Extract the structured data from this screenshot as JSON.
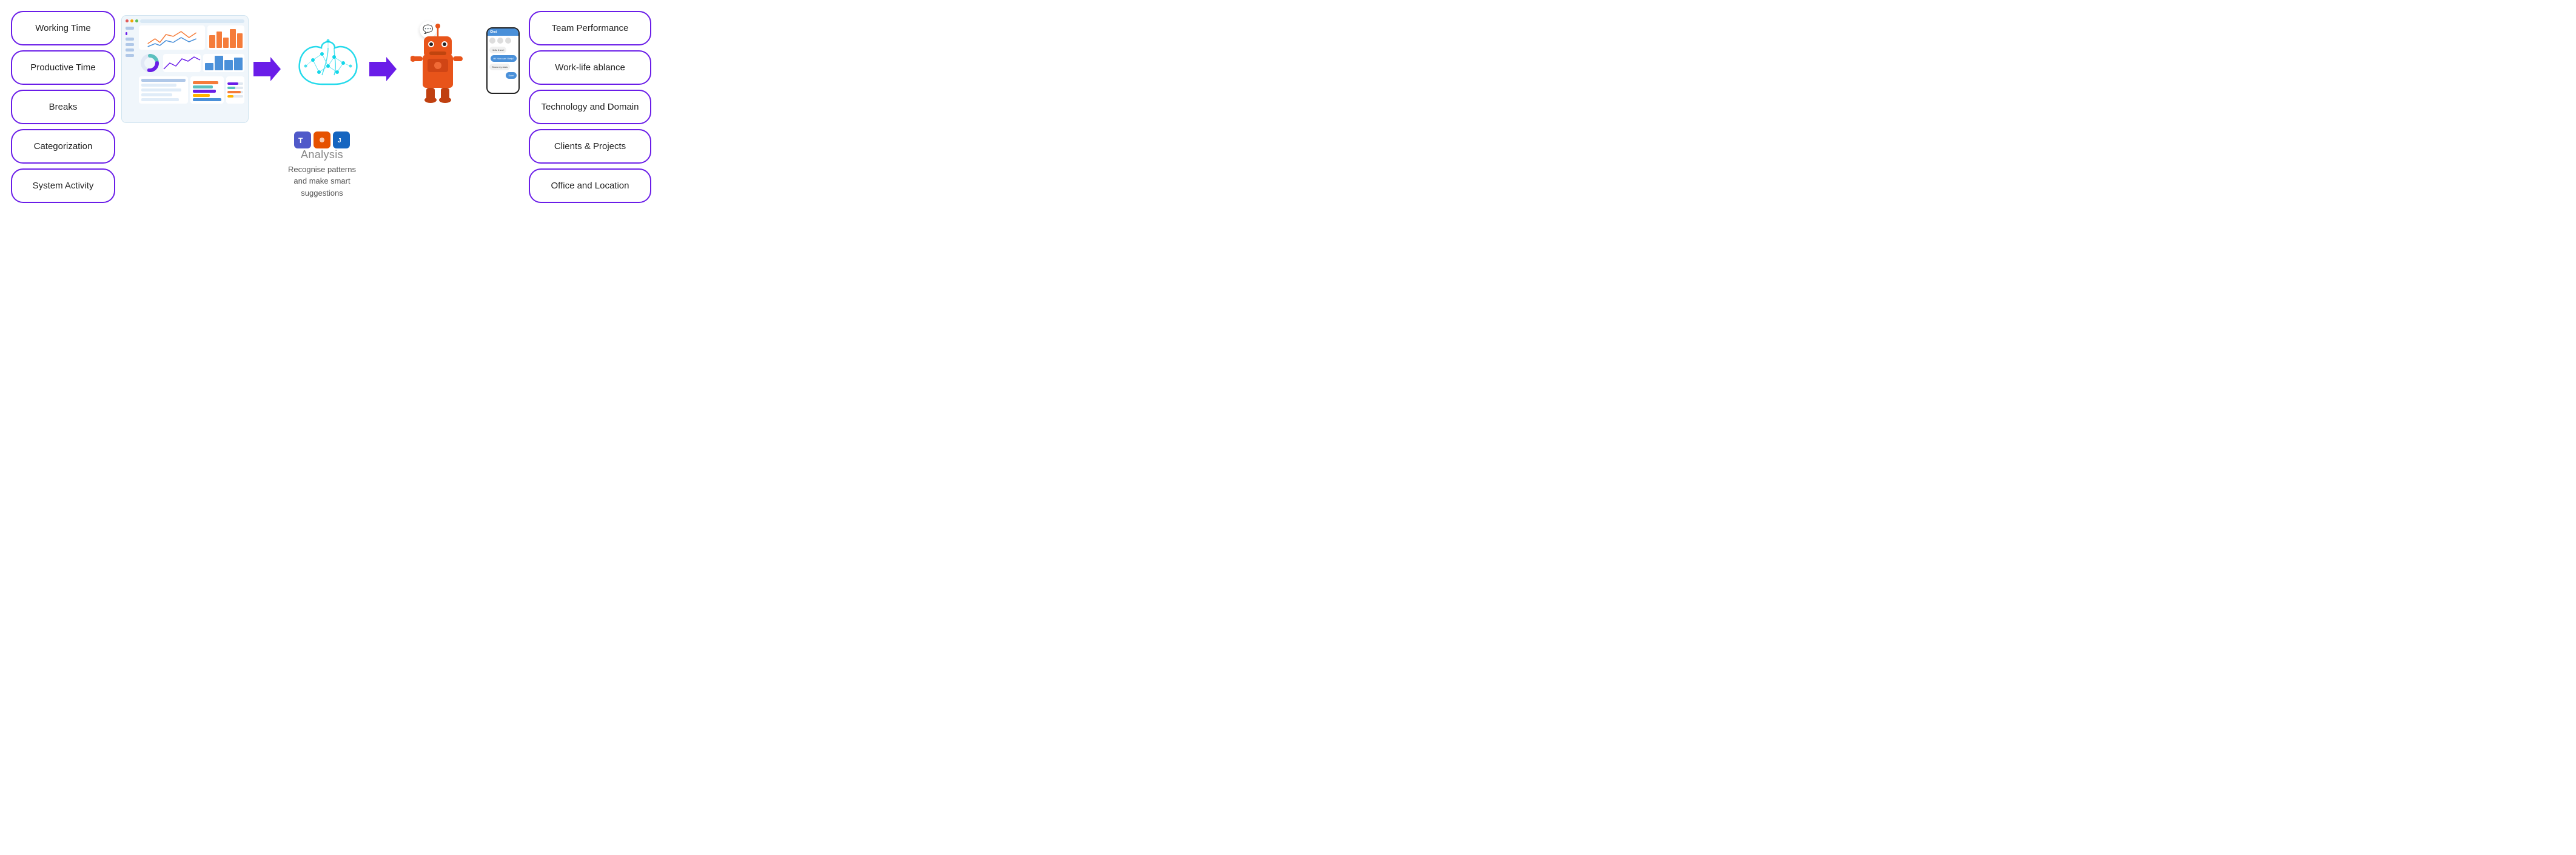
{
  "left_col": {
    "items": [
      {
        "label": "Working Time",
        "id": "working-time"
      },
      {
        "label": "Productive Time",
        "id": "productive-time"
      },
      {
        "label": "Breaks",
        "id": "breaks"
      },
      {
        "label": "Categorization",
        "id": "categorization"
      },
      {
        "label": "System Activity",
        "id": "system-activity"
      }
    ]
  },
  "right_col": {
    "items": [
      {
        "label": "Team Performance",
        "id": "team-performance"
      },
      {
        "label": "Work-life ablance",
        "id": "work-life-balance"
      },
      {
        "label": "Technology and Domain",
        "id": "technology-domain"
      },
      {
        "label": "Clients & Projects",
        "id": "clients-projects"
      },
      {
        "label": "Office and Location",
        "id": "office-location"
      }
    ]
  },
  "center": {
    "analysis_label": "Analysis",
    "ai_description": "Recognise patterns\nand make smart\nsuggestions"
  },
  "bars": {
    "colors": [
      "#f57c3a",
      "#5bc0be",
      "#6a1de8",
      "#ffb300",
      "#4a90d9"
    ]
  }
}
